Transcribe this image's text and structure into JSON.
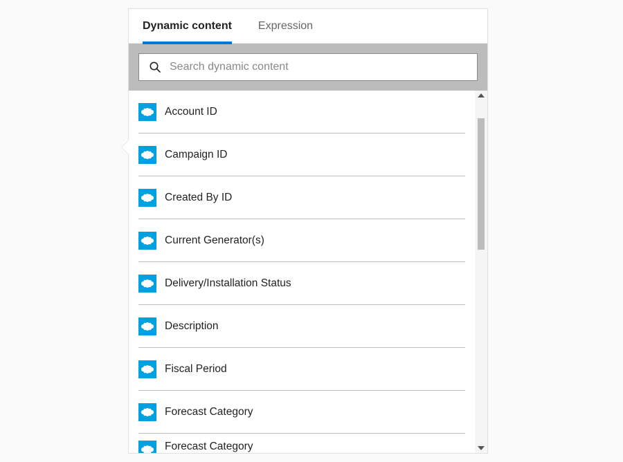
{
  "tabs": {
    "dynamic": "Dynamic content",
    "expression": "Expression"
  },
  "search": {
    "placeholder": "Search dynamic content"
  },
  "items": [
    {
      "label": "Account ID"
    },
    {
      "label": "Campaign ID"
    },
    {
      "label": "Created By ID"
    },
    {
      "label": "Current Generator(s)"
    },
    {
      "label": "Delivery/Installation Status"
    },
    {
      "label": "Description"
    },
    {
      "label": "Fiscal Period"
    },
    {
      "label": "Forecast Category"
    },
    {
      "label": "Forecast Category"
    }
  ],
  "colors": {
    "accent": "#0078d4",
    "salesforce": "#00a1e0"
  }
}
